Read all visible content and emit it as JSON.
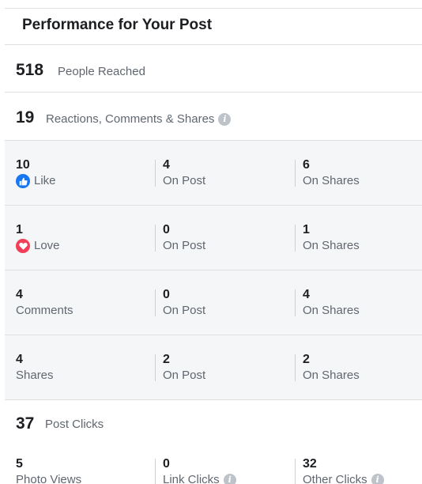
{
  "header": {
    "title": "Performance for Your Post"
  },
  "reach": {
    "value": "518",
    "label": "People Reached"
  },
  "engagement": {
    "value": "19",
    "label": "Reactions, Comments & Shares"
  },
  "rows": [
    {
      "value": "10",
      "label": "Like",
      "icon": "like-icon",
      "on_post_value": "4",
      "on_post_label": "On Post",
      "on_shares_value": "6",
      "on_shares_label": "On Shares"
    },
    {
      "value": "1",
      "label": "Love",
      "icon": "love-icon",
      "on_post_value": "0",
      "on_post_label": "On Post",
      "on_shares_value": "1",
      "on_shares_label": "On Shares"
    },
    {
      "value": "4",
      "label": "Comments",
      "on_post_value": "0",
      "on_post_label": "On Post",
      "on_shares_value": "4",
      "on_shares_label": "On Shares"
    },
    {
      "value": "4",
      "label": "Shares",
      "on_post_value": "2",
      "on_post_label": "On Post",
      "on_shares_value": "2",
      "on_shares_label": "On Shares"
    }
  ],
  "post_clicks": {
    "value": "37",
    "label": "Post Clicks",
    "photo_views": {
      "value": "5",
      "label": "Photo Views"
    },
    "link_clicks": {
      "value": "0",
      "label": "Link Clicks"
    },
    "other_clicks": {
      "value": "32",
      "label": "Other Clicks"
    }
  },
  "info_icon_glyph": "i",
  "colors": {
    "like": "#1877f2",
    "love": "#f33e58",
    "muted_text": "#606770",
    "divider": "#dddfe2"
  }
}
